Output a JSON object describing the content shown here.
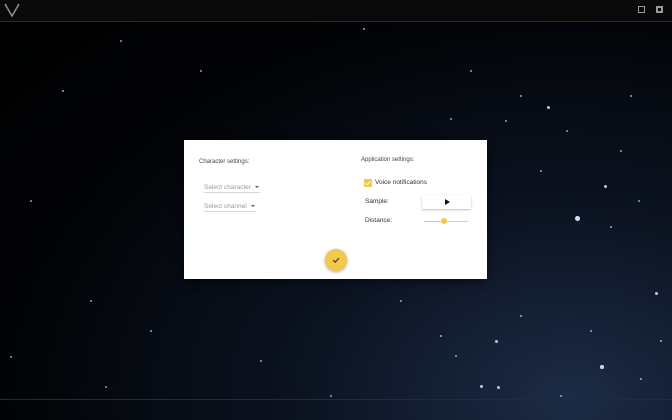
{
  "app": {
    "logo_icon": "v-logo-icon",
    "window_buttons": [
      "restore-icon",
      "panel-icon"
    ]
  },
  "dialog": {
    "character": {
      "title": "Character settings:",
      "select_character": "Select character",
      "select_channel": "Select channel"
    },
    "application": {
      "title": "Application settings:",
      "voice_notifications_label": "Voice notifications",
      "voice_notifications_checked": true,
      "sample_label": "Sample:",
      "sample_button_icon": "play-icon",
      "distance_label": "Distance:",
      "distance_fraction": 0.45
    },
    "confirm_icon": "check-icon"
  },
  "colors": {
    "accent": "#f2c94c",
    "dialog_bg": "#ffffff",
    "background": "#000000"
  }
}
